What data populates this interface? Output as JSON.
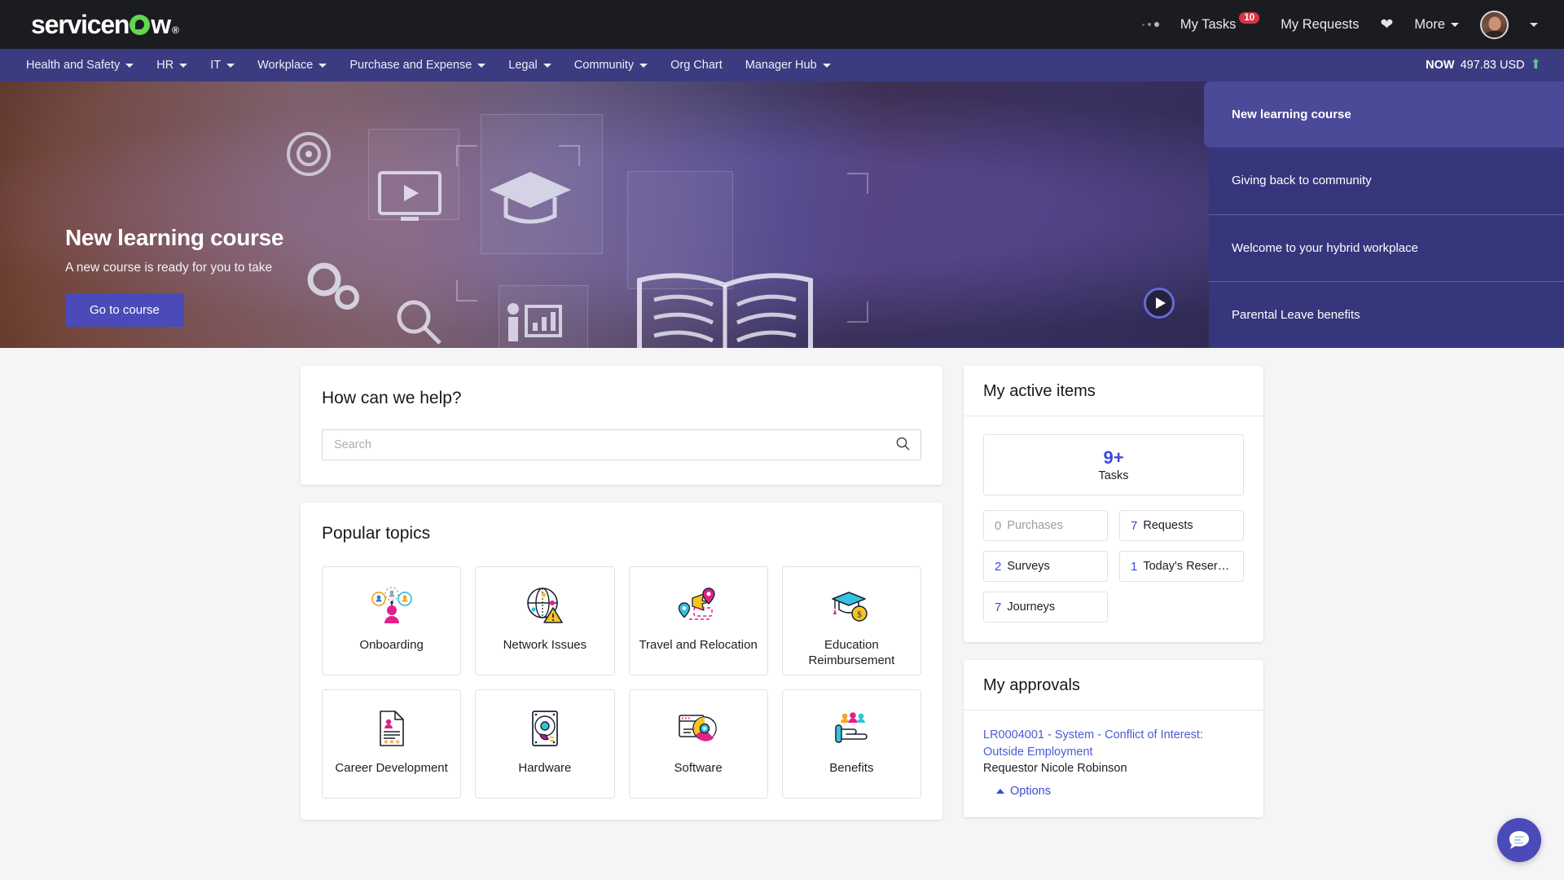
{
  "brand": {
    "logo_text_before": "servicen",
    "logo_text_after": "w",
    "logo_registered": "®",
    "accent_green": "#62d84e",
    "accent_indigo": "#4a4ab8",
    "nav_purple": "#3b3b82",
    "link_blue": "#3a4ad6",
    "badge_red": "#d93545"
  },
  "topbar": {
    "my_tasks_label": "My Tasks",
    "my_tasks_badge": "10",
    "my_requests_label": "My Requests",
    "favorites_icon": "heart-icon",
    "more_label": "More",
    "loading_icon": "loading-dots-icon",
    "avatar_icon": "user-avatar"
  },
  "navbar": {
    "items": [
      {
        "label": "Health and Safety",
        "has_caret": true
      },
      {
        "label": "HR",
        "has_caret": true
      },
      {
        "label": "IT",
        "has_caret": true
      },
      {
        "label": "Workplace",
        "has_caret": true
      },
      {
        "label": "Purchase and Expense",
        "has_caret": true
      },
      {
        "label": "Legal",
        "has_caret": true
      },
      {
        "label": "Community",
        "has_caret": true
      },
      {
        "label": "Org Chart",
        "has_caret": false
      },
      {
        "label": "Manager Hub",
        "has_caret": true
      }
    ],
    "ticker_symbol": "NOW",
    "ticker_value": "497.83 USD",
    "ticker_direction_icon": "arrow-up-icon"
  },
  "hero": {
    "title": "New learning course",
    "subtitle": "A new course is ready for you to take",
    "button_label": "Go to course",
    "play_icon": "play-button-icon",
    "carousel": [
      {
        "label": "New learning course",
        "active": true
      },
      {
        "label": "Giving back to community",
        "active": false
      },
      {
        "label": "Welcome to your hybrid workplace",
        "active": false
      },
      {
        "label": "Parental Leave benefits",
        "active": false
      }
    ]
  },
  "help": {
    "title": "How can we help?",
    "search_placeholder": "Search",
    "search_value": "",
    "search_icon": "search-icon"
  },
  "topics": {
    "title": "Popular topics",
    "tiles": [
      {
        "label": "Onboarding",
        "icon": "onboarding-people-icon"
      },
      {
        "label": "Network Issues",
        "icon": "globe-warning-icon"
      },
      {
        "label": "Travel and Relocation",
        "icon": "travel-plane-pin-icon"
      },
      {
        "label": "Education Reimbursement",
        "icon": "graduation-cap-coin-icon"
      },
      {
        "label": "Career Development",
        "icon": "document-stars-icon"
      },
      {
        "label": "Hardware",
        "icon": "hard-drive-icon"
      },
      {
        "label": "Software",
        "icon": "software-disc-icon"
      },
      {
        "label": "Benefits",
        "icon": "hand-people-icon"
      }
    ]
  },
  "active_items": {
    "title": "My active items",
    "primary": {
      "count": "9+",
      "label": "Tasks"
    },
    "stats": [
      {
        "count": "0",
        "label": "Purchases",
        "zero": true
      },
      {
        "count": "7",
        "label": "Requests",
        "zero": false
      },
      {
        "count": "2",
        "label": "Surveys",
        "zero": false
      },
      {
        "count": "1",
        "label": "Today's Reservati...",
        "zero": false
      },
      {
        "count": "7",
        "label": "Journeys",
        "zero": false
      }
    ]
  },
  "approvals": {
    "title": "My approvals",
    "items": [
      {
        "link": "LR0004001 - System - Conflict of Interest: Outside Employment",
        "requestor": "Requestor Nicole Robinson",
        "options_label": "Options"
      }
    ]
  },
  "chat": {
    "icon": "chat-bubble-icon"
  }
}
